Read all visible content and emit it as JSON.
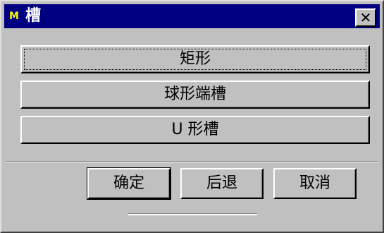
{
  "window": {
    "title": "槽",
    "app_icon_glyph": "M",
    "close_glyph": "✕"
  },
  "options": {
    "rect_label": "矩形",
    "ball_end_label": "球形端槽",
    "u_slot_label": "U 形槽"
  },
  "actions": {
    "ok_label": "确定",
    "back_label": "后退",
    "cancel_label": "取消"
  },
  "colors": {
    "titlebar": "#000080",
    "face": "#c0c0c0"
  }
}
